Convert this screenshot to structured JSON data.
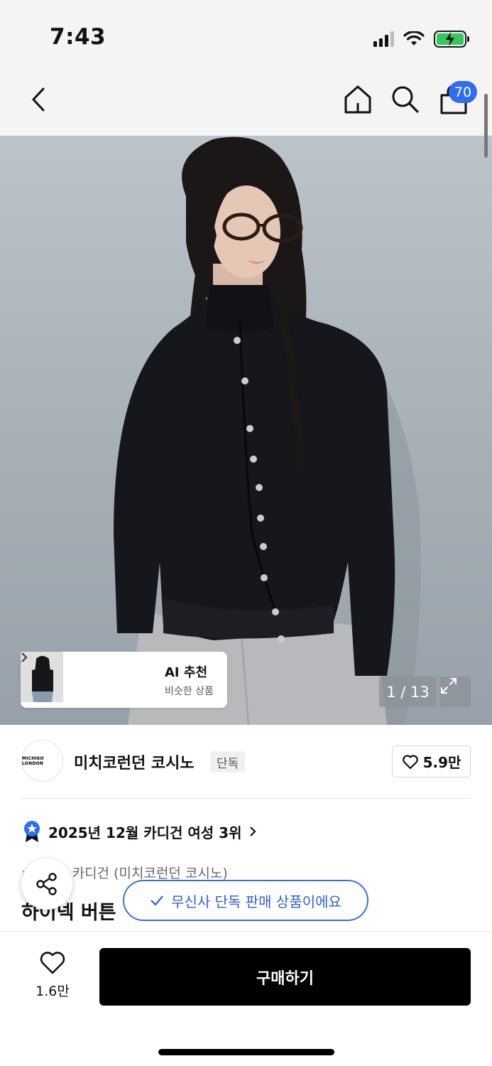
{
  "status_bar": {
    "time": "7:43"
  },
  "header": {
    "cart_count": "70"
  },
  "hero": {
    "counter": "1 / 13"
  },
  "ai_recommend": {
    "title": "AI 추천",
    "subtitle": "비슷한 상품"
  },
  "brand": {
    "name": "미치코런던 코시노",
    "tag": "단독",
    "logo_text": "MICHIKO LONDON",
    "likes": "5.9만"
  },
  "ranking": {
    "text": "2025년 12월 카디건 여성 3위"
  },
  "product": {
    "category": "카디건 (미치코런던 코시노)",
    "title": "하이넥 버튼"
  },
  "toast": {
    "text": "무신사 단독 판매 상품이에요"
  },
  "bottom": {
    "wish_count": "1.6만",
    "buy_label": "구매하기"
  },
  "colors": {
    "accent_blue": "#2f6dee",
    "buy_button": "#000000",
    "battery_green": "#34c759"
  }
}
